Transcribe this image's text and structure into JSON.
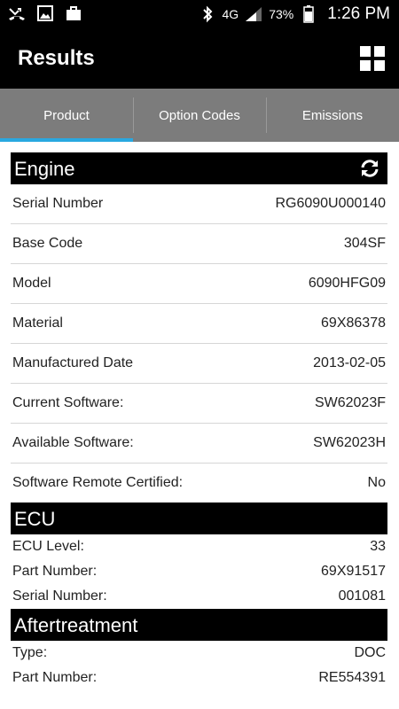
{
  "status_bar": {
    "left_icons": [
      "missed-call-icon",
      "image-icon",
      "briefcase-icon"
    ],
    "network": "4G",
    "battery": "73%",
    "time": "1:26 PM"
  },
  "app_bar": {
    "title": "Results",
    "menu_icon": "grid-icon"
  },
  "tabs": [
    {
      "label": "Product",
      "active": true
    },
    {
      "label": "Option Codes",
      "active": false
    },
    {
      "label": "Emissions",
      "active": false
    }
  ],
  "sections": {
    "engine": {
      "title": "Engine",
      "rows": [
        {
          "label": "Serial Number",
          "value": "RG6090U000140"
        },
        {
          "label": "Base Code",
          "value": "304SF"
        },
        {
          "label": "Model",
          "value": "6090HFG09"
        },
        {
          "label": "Material",
          "value": "69X86378"
        },
        {
          "label": "Manufactured Date",
          "value": "2013-02-05"
        },
        {
          "label": "Current Software:",
          "value": "SW62023F"
        },
        {
          "label": "Available Software:",
          "value": "SW62023H"
        },
        {
          "label": "Software Remote Certified:",
          "value": "No"
        }
      ]
    },
    "ecu": {
      "title": "ECU",
      "rows": [
        {
          "label": "ECU Level:",
          "value": "33"
        },
        {
          "label": "Part Number:",
          "value": "69X91517"
        },
        {
          "label": "Serial Number:",
          "value": "001081"
        }
      ]
    },
    "aftertreatment": {
      "title": "Aftertreatment",
      "rows": [
        {
          "label": "Type:",
          "value": "DOC"
        },
        {
          "label": "Part Number:",
          "value": "RE554391"
        }
      ]
    }
  }
}
